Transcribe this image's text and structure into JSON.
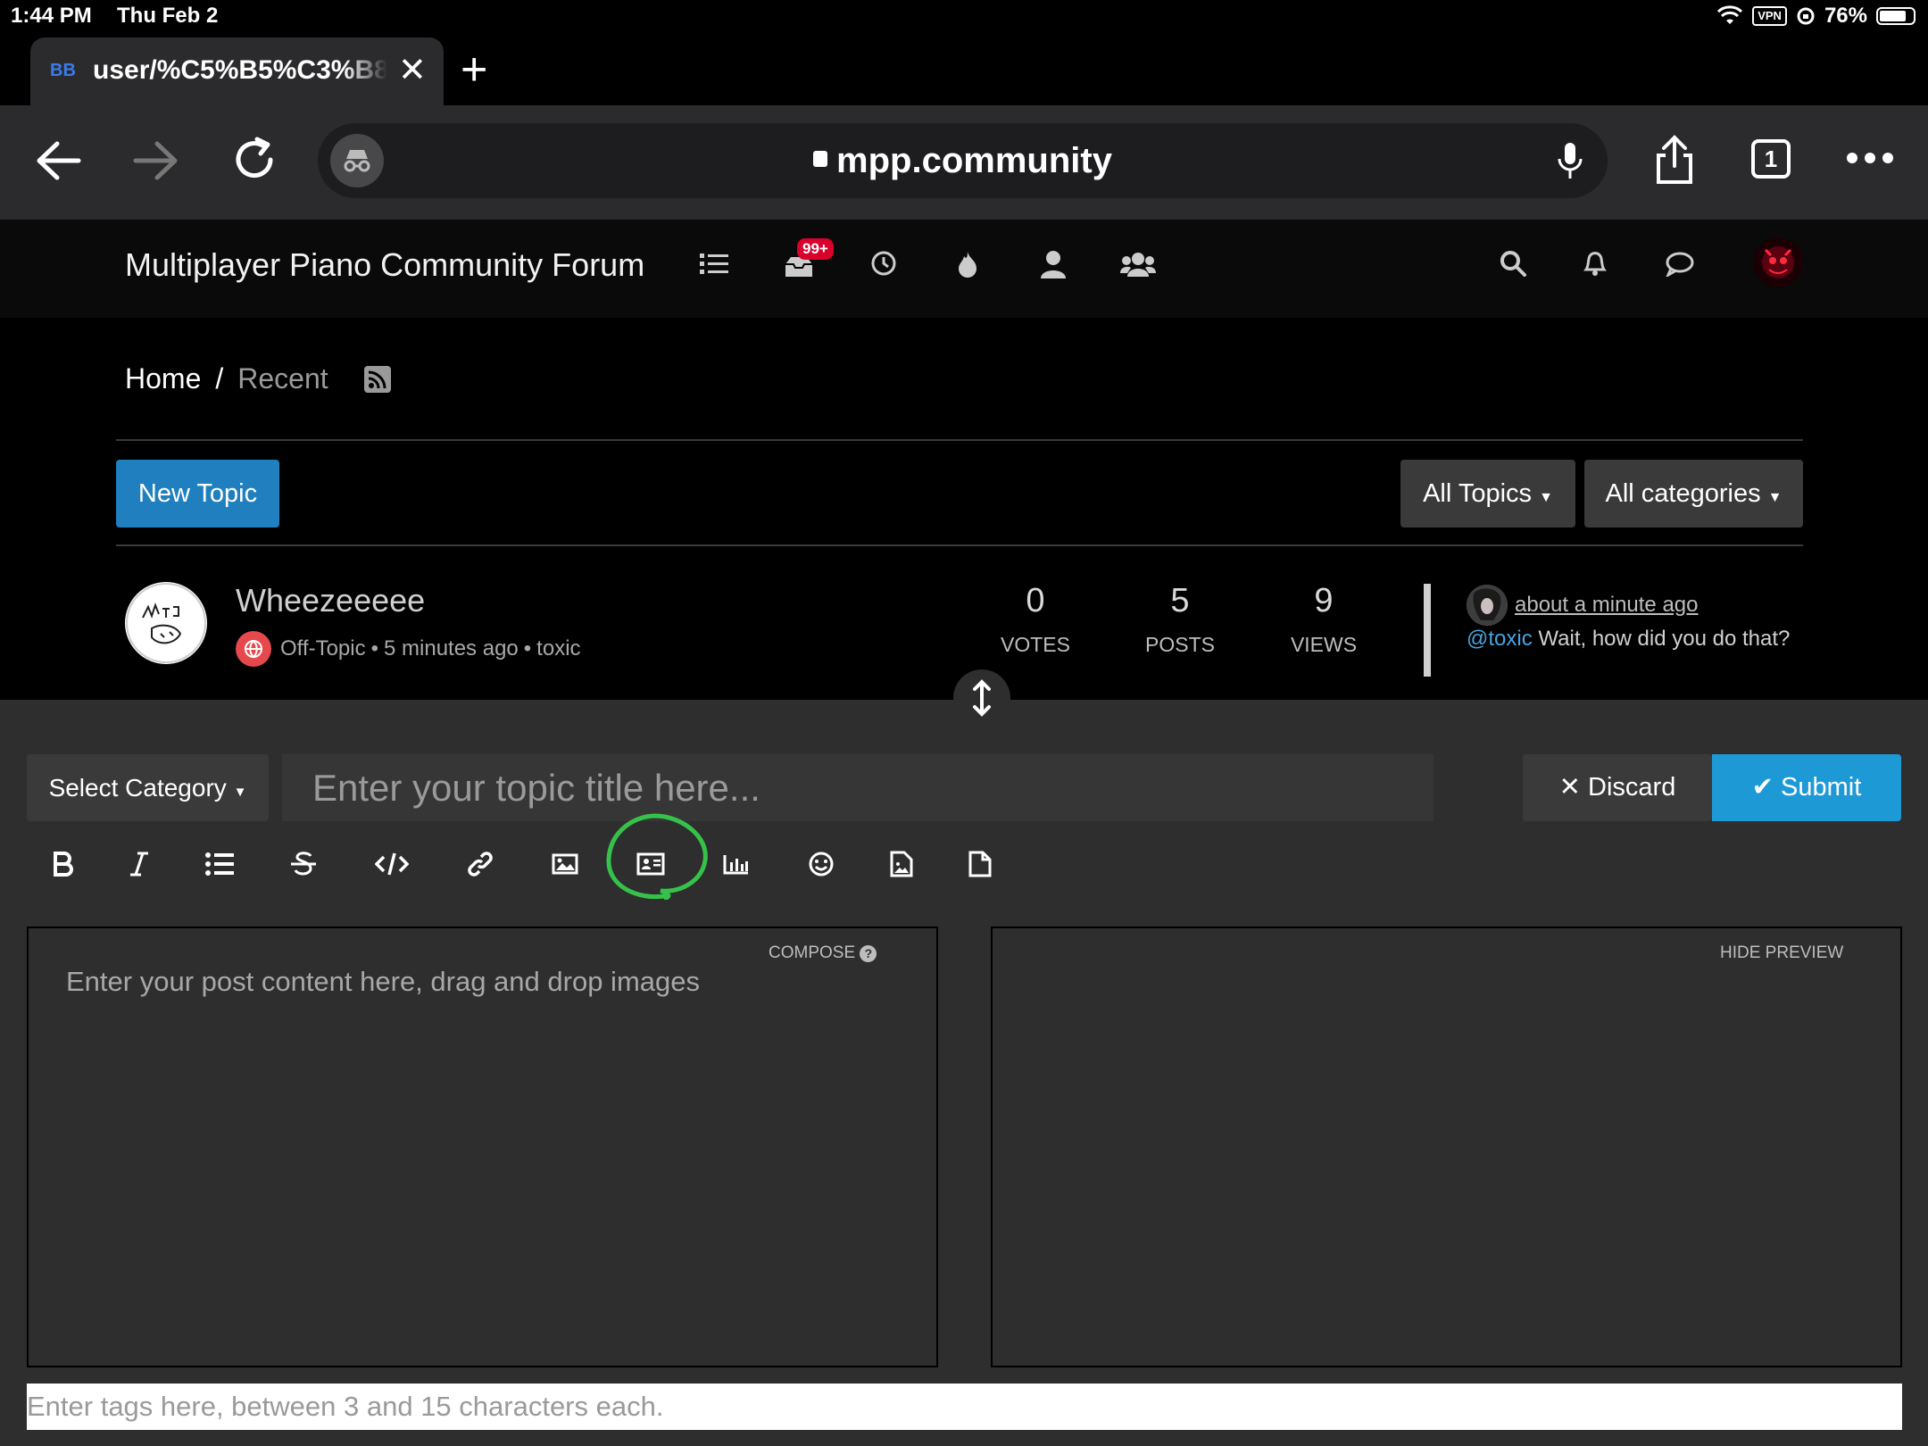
{
  "status_bar": {
    "time": "1:44 PM",
    "date": "Thu Feb 2",
    "vpn": "VPN",
    "battery": "76%"
  },
  "browser": {
    "tab_title": "user/%C5%B5%C3%B8",
    "favicon": "BB",
    "url": "mpp.community",
    "tab_count": "1"
  },
  "forum": {
    "brand": "Multiplayer Piano Community Forum",
    "unread_badge": "99+",
    "breadcrumb": {
      "home": "Home",
      "separator": "/",
      "current": "Recent"
    },
    "new_topic_label": "New Topic",
    "filter_topics_label": "All Topics",
    "filter_categories_label": "All categories",
    "topic": {
      "title": "Wheezeeeee",
      "category": "Off-Topic",
      "time": "5 minutes ago",
      "tag": "toxic",
      "bullet": "•",
      "votes": "0",
      "votes_label": "VOTES",
      "posts": "5",
      "posts_label": "POSTS",
      "views": "9",
      "views_label": "VIEWS",
      "teaser_time": "about a minute ago",
      "teaser_mention": "@toxic",
      "teaser_text": "Wait, how did you do that?"
    }
  },
  "composer": {
    "select_category": "Select Category",
    "title_placeholder": "Enter your topic title here...",
    "discard_label": "Discard",
    "submit_label": "Submit",
    "compose_label": "COMPOSE",
    "hide_preview_label": "HIDE PREVIEW",
    "content_placeholder": "Enter your post content here, drag and drop images",
    "tags_placeholder": "Enter tags here, between 3 and 15 characters each."
  },
  "colors": {
    "primary": "#1f7fbf",
    "submit": "#1d9ad6",
    "badge": "#d9002b",
    "annotation": "#36c24a",
    "category": "#e5484d"
  }
}
